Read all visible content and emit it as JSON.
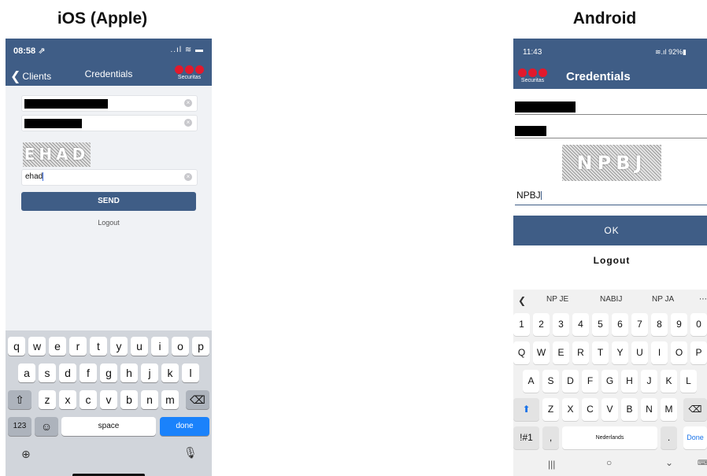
{
  "captions": {
    "ios": "iOS (Apple)",
    "android": "Android"
  },
  "ios": {
    "status_time": "08:58 ⇗",
    "status_icons": "..ıl ≋ ▬",
    "nav": {
      "back_label": "Clients",
      "title": "Credentials",
      "logo_text": "Securitas"
    },
    "captcha_text": "EHAD",
    "captcha_input": "ehad",
    "send_label": "SEND",
    "logout_label": "Logout",
    "keyboard": {
      "row1": [
        "q",
        "w",
        "e",
        "r",
        "t",
        "y",
        "u",
        "i",
        "o",
        "p"
      ],
      "row2": [
        "a",
        "s",
        "d",
        "f",
        "g",
        "h",
        "j",
        "k",
        "l"
      ],
      "row3": [
        "z",
        "x",
        "c",
        "v",
        "b",
        "n",
        "m"
      ],
      "numbers_label": "123",
      "space_label": "space",
      "done_label": "done"
    }
  },
  "android": {
    "status_time": "11:43",
    "status_icons": "≋.ıl 92%▮",
    "appbar": {
      "logo_text": "Securitas",
      "title": "Credentials"
    },
    "captcha_text": "NPBJ",
    "captcha_input": "NPBJ",
    "ok_label": "OK",
    "logout_label": "Logout",
    "keyboard": {
      "suggestions": [
        "NP JE",
        "NABIJ",
        "NP JA"
      ],
      "numbers": [
        "1",
        "2",
        "3",
        "4",
        "5",
        "6",
        "7",
        "8",
        "9",
        "0"
      ],
      "row1": [
        "Q",
        "W",
        "E",
        "R",
        "T",
        "Y",
        "U",
        "I",
        "O",
        "P"
      ],
      "row2": [
        "A",
        "S",
        "D",
        "F",
        "G",
        "H",
        "J",
        "K",
        "L"
      ],
      "row3": [
        "Z",
        "X",
        "C",
        "V",
        "B",
        "N",
        "M"
      ],
      "symbols_label": "!#1",
      "comma_label": ",",
      "space_label": "Nederlands",
      "period_label": ".",
      "done_label": "Done"
    }
  }
}
